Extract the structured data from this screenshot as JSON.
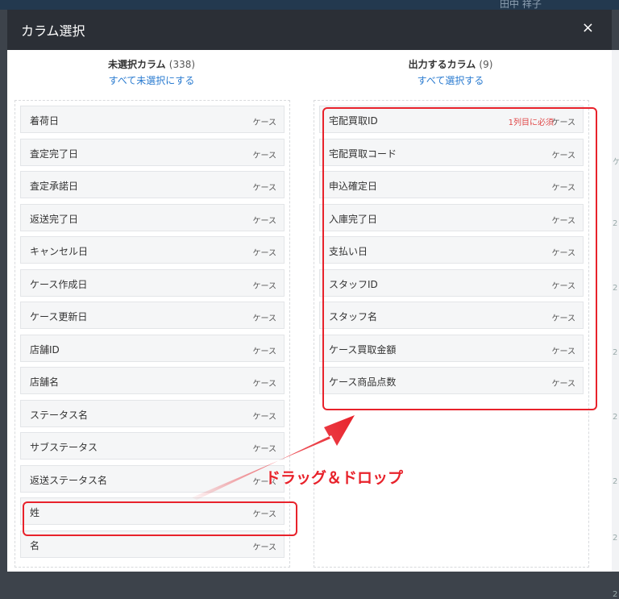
{
  "background": {
    "top_text": "田中 祥子",
    "side_marks": [
      "ケ",
      "2",
      "2",
      "2",
      "2",
      "2",
      "2",
      "2"
    ]
  },
  "modal": {
    "title": "カラム選択",
    "close_glyph": "×"
  },
  "unselected": {
    "title": "未選択カラム",
    "count": "(338)",
    "action_label": "すべて未選択にする",
    "items": [
      {
        "name": "着荷日",
        "type": "ケース"
      },
      {
        "name": "査定完了日",
        "type": "ケース"
      },
      {
        "name": "査定承諾日",
        "type": "ケース"
      },
      {
        "name": "返送完了日",
        "type": "ケース"
      },
      {
        "name": "キャンセル日",
        "type": "ケース"
      },
      {
        "name": "ケース作成日",
        "type": "ケース"
      },
      {
        "name": "ケース更新日",
        "type": "ケース"
      },
      {
        "name": "店舗ID",
        "type": "ケース"
      },
      {
        "name": "店舗名",
        "type": "ケース"
      },
      {
        "name": "ステータス名",
        "type": "ケース"
      },
      {
        "name": "サブステータス",
        "type": "ケース"
      },
      {
        "name": "返送ステータス名",
        "type": "ケース"
      },
      {
        "name": "姓",
        "type": "ケース"
      },
      {
        "name": "名",
        "type": "ケース"
      }
    ]
  },
  "selected": {
    "title": "出力するカラム",
    "count": "(9)",
    "action_label": "すべて選択する",
    "items": [
      {
        "name": "宅配買取ID",
        "type": "ケース",
        "required": "1列目に必須"
      },
      {
        "name": "宅配買取コード",
        "type": "ケース"
      },
      {
        "name": "申込確定日",
        "type": "ケース"
      },
      {
        "name": "入庫完了日",
        "type": "ケース"
      },
      {
        "name": "支払い日",
        "type": "ケース"
      },
      {
        "name": "スタッフID",
        "type": "ケース"
      },
      {
        "name": "スタッフ名",
        "type": "ケース"
      },
      {
        "name": "ケース買取金額",
        "type": "ケース"
      },
      {
        "name": "ケース商品点数",
        "type": "ケース"
      }
    ]
  },
  "annotation": {
    "label": "ドラッグ＆ドロップ",
    "color": "#e8222b"
  }
}
